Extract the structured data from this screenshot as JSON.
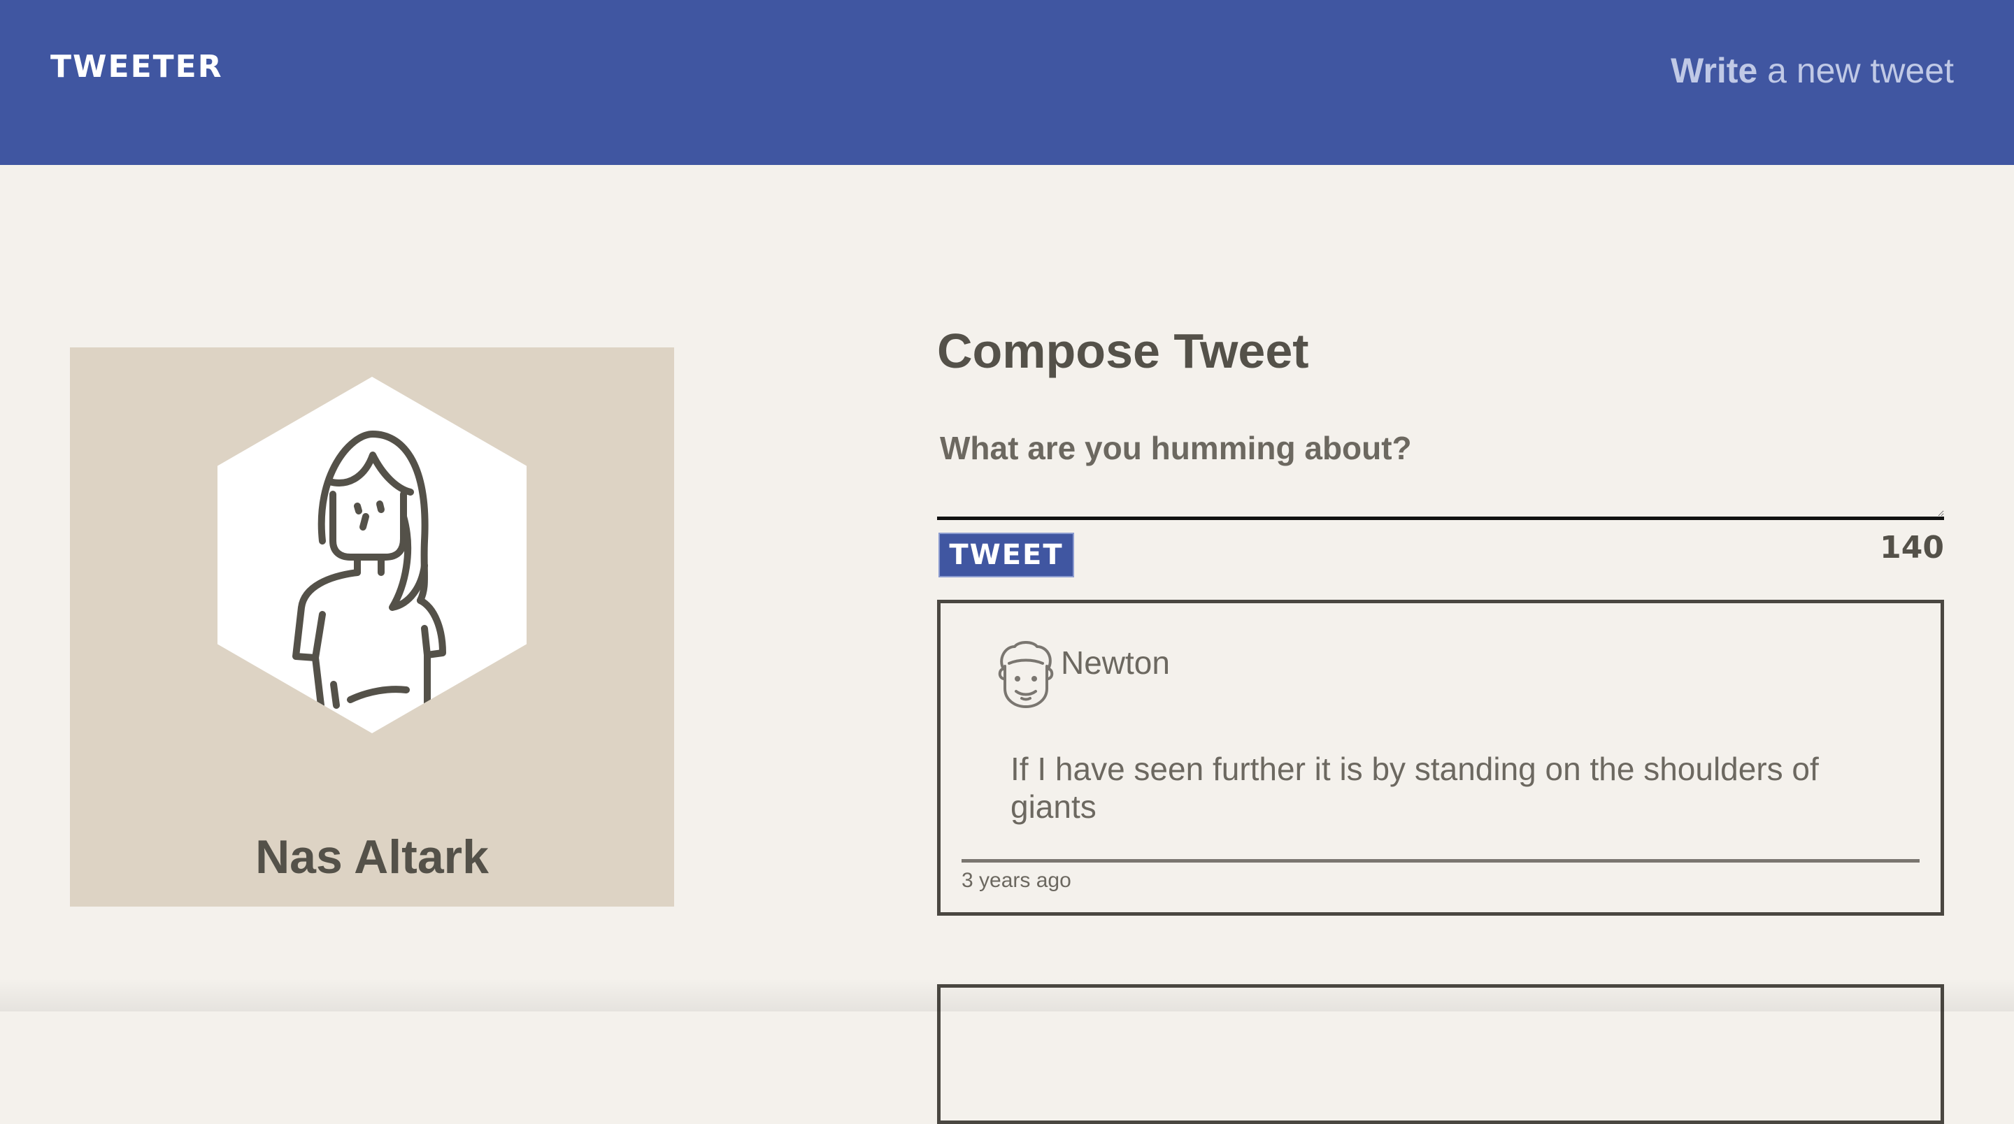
{
  "navbar": {
    "brand": "TWEETER",
    "compose_strong": "Write",
    "compose_rest": " a new tweet"
  },
  "profile": {
    "name": "Nas Altark",
    "avatar_icon": "woman-avatar-icon"
  },
  "compose": {
    "title": "Compose Tweet",
    "placeholder": "What are you humming about?",
    "button_label": "TWEET",
    "counter": "140"
  },
  "tweets": [
    {
      "author": "Newton",
      "avatar_icon": "man-curly-hair-avatar-icon",
      "text": "If I have seen further it is by standing on the shoulders of giants",
      "time": "3 years ago"
    }
  ],
  "colors": {
    "nav_bg": "#4056a1",
    "page_bg": "#f4f1ec",
    "profile_bg": "#ddd3c4",
    "text_dark": "#545149"
  }
}
